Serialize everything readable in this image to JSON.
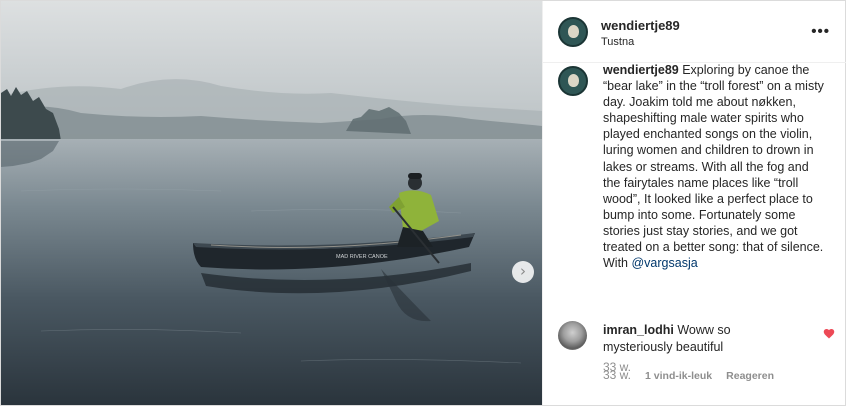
{
  "post": {
    "username": "wendiertje89",
    "location": "Tustna",
    "more_label": "•••",
    "caption": {
      "username": "wendiertje89",
      "text": "Exploring by canoe the “bear lake” in the “troll forest” on a misty day. Joakim told me about nøkken, shapeshifting male water spirits who played enchanted songs on the violin, luring women and children to drown in lakes or streams. With all the fog and the fairytales name places like “troll wood”, It looked like a perfect place to bump into some. Fortunately some stories just stay stories, and we got treated on a better song: that of silence.",
      "with_label": "With",
      "mention": "@vargsasja",
      "time": "33 w."
    },
    "comment": {
      "username": "imran_lodhi",
      "text": "Woww so mysteriously beautiful",
      "time": "33 w.",
      "likes": "1 vind-ik-leuk",
      "reply": "Reageren"
    },
    "photo": {
      "description_icon": "next-arrow-icon",
      "next_glyph": "›",
      "canoe_brand": "MAD RIVER CANOE"
    },
    "colors": {
      "heart": "#ed4956",
      "meta": "#8e8e8e",
      "mention": "#00376b"
    }
  }
}
